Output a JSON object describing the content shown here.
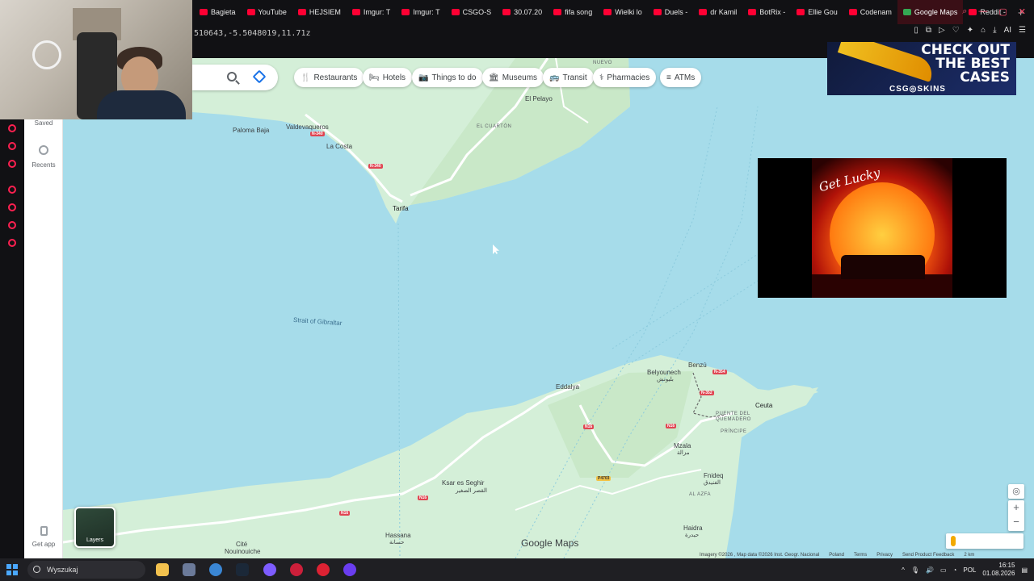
{
  "browser": {
    "tabs": [
      {
        "label": "Bagieta"
      },
      {
        "label": "YouTube"
      },
      {
        "label": "HEJSIEM"
      },
      {
        "label": "Imgur: T"
      },
      {
        "label": "Imgur: T"
      },
      {
        "label": "CSGO-S"
      },
      {
        "label": "30.07.20"
      },
      {
        "label": "fifa song"
      },
      {
        "label": "Wielki lo"
      },
      {
        "label": "Duels -"
      },
      {
        "label": "dr Kamil"
      },
      {
        "label": "BotRix -"
      },
      {
        "label": "Ellie Gou"
      },
      {
        "label": "Codenam"
      },
      {
        "label": "Google Maps",
        "active": true
      },
      {
        "label": "Reddit -"
      }
    ],
    "new_tab": "+",
    "url_fragment": "510643,-5.5048019,11.71z",
    "ai_label": "AI"
  },
  "maps": {
    "sidebar": {
      "saved": "Saved",
      "recents": "Recents",
      "get_app": "Get app"
    },
    "chips": [
      {
        "icon": "fork-knife-icon",
        "glyph": "🍴",
        "label": "Restaurants"
      },
      {
        "icon": "bed-icon",
        "glyph": "🛏",
        "label": "Hotels"
      },
      {
        "icon": "camera-icon",
        "glyph": "📷",
        "label": "Things to do"
      },
      {
        "icon": "museum-icon",
        "glyph": "🏛",
        "label": "Museums"
      },
      {
        "icon": "bus-icon",
        "glyph": "🚌",
        "label": "Transit"
      },
      {
        "icon": "pharmacy-icon",
        "glyph": "⚕",
        "label": "Pharmacies"
      },
      {
        "icon": "atm-icon",
        "glyph": "≡",
        "label": "ATMs"
      }
    ],
    "places": {
      "nuevo": "NUEVO",
      "el_pelayo": "El Pelayo",
      "paloma_baja": "Paloma Baja",
      "valdevaqueros": "Valdevaqueros",
      "el_cuarton": "EL CUARTÓN",
      "la_costa": "La Costa",
      "tarifa": "Tarifa",
      "strait": "Strait of Gibraltar",
      "benzu": "Benzú",
      "belyounech": "Belyounech",
      "belyounech_ar": "بليونش",
      "eddalya": "Eddalya",
      "ceuta": "Ceuta",
      "puente": "PUENTE DEL",
      "quemadero": "QUEMADERO",
      "principe": "PRÍNCIPE",
      "mzala": "Mzala",
      "mzala_ar": "مزالة",
      "ksar": "Ksar es Seghir",
      "ksar_ar": "القصر الصغير",
      "fnideq": "Fnideq",
      "fnideq_ar": "الفنيدق",
      "al_azfa": "AL AZFA",
      "haidra": "Haidra",
      "haidra_ar": "حيدرة",
      "hassana": "Hassana",
      "hassana_ar": "حسانة",
      "cite": "Cité",
      "nouinouiche": "Nouinouiche"
    },
    "shields": {
      "n340a": "N-340",
      "n340b": "N-340",
      "n354": "N-354",
      "n352": "N-352",
      "n16a": "N16",
      "n16b": "N16",
      "n16c": "N16",
      "n16d": "N16",
      "p4703": "P4703"
    },
    "logo": "Google Maps",
    "layers_label": "Layers",
    "attribution": [
      "Imagery ©2026 , Map data ©2026 Inst. Geogr. Nacional",
      "Poland",
      "Terms",
      "Privacy",
      "Send Product Feedback",
      "2 km"
    ],
    "zoom_in": "+",
    "zoom_out": "−"
  },
  "overlays": {
    "ad_text": "CHECK OUT THE BEST CASES",
    "ad_brand": "CSG◎SKINS",
    "album_text": "Get Lucky"
  },
  "taskbar": {
    "search_placeholder": "Wyszukaj",
    "lang": "POL",
    "time": "16:15",
    "date": "01.08.2026"
  },
  "colors": {
    "sea": "#a6dcea",
    "land": "#d4efd8",
    "road": "#ffffff",
    "accent": "#ff2050"
  }
}
